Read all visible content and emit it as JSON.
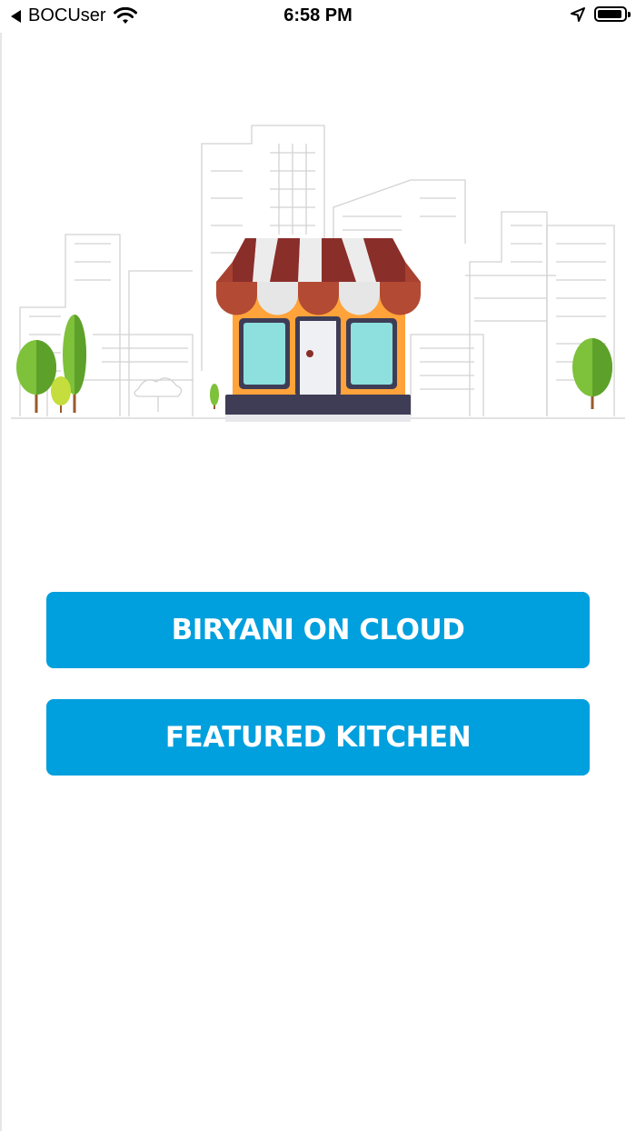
{
  "status_bar": {
    "back_label": "BOCUser",
    "time": "6:58 PM",
    "icons": [
      "back-arrow-icon",
      "wifi-icon",
      "location-arrow-icon",
      "battery-icon"
    ]
  },
  "illustration": {
    "name": "storefront-cityscape-illustration",
    "colors": {
      "awning_red": "#a8412f",
      "awning_dark_red": "#8a2e2a",
      "awning_white": "#ececec",
      "shop_orange": "#ffa33a",
      "window_teal": "#8de0dd",
      "shop_base": "#3f3d56",
      "tree_green": "#7ec13a",
      "sketch_gray": "#cfcfcf"
    }
  },
  "buttons": {
    "biryani_label": "BIRYANI ON CLOUD",
    "kitchen_label": "FEATURED KITCHEN",
    "color": "#009fdd"
  }
}
